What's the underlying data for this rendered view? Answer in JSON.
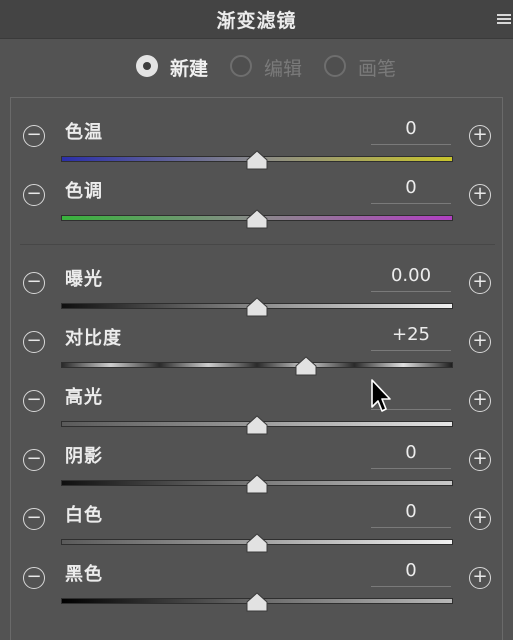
{
  "panel": {
    "title": "渐变滤镜",
    "menu_icon": "hamburger-menu-icon"
  },
  "modes": [
    {
      "label": "新建",
      "selected": true
    },
    {
      "label": "编辑",
      "selected": false
    },
    {
      "label": "画笔",
      "selected": false
    }
  ],
  "buttons": {
    "minus": "−",
    "plus": "+"
  },
  "sliders": [
    {
      "label": "色温",
      "value": "0",
      "position": 0.5,
      "gradient": [
        "#2b2fa8",
        "#8a8a8a",
        "#c8c42c"
      ]
    },
    {
      "label": "色调",
      "value": "0",
      "position": 0.5,
      "gradient": [
        "#38b23c",
        "#8a8a8a",
        "#b03fc1"
      ]
    },
    {
      "label": "曝光",
      "value": "0.00",
      "position": 0.5,
      "gradient": [
        "#0f0f0f",
        "#8a8a8a",
        "#f0f0f0"
      ]
    },
    {
      "label": "对比度",
      "value": "+25",
      "position": 0.625,
      "gradient": [
        "#2a2a2a",
        "#cfcfcf",
        "#2a2a2a",
        "#cfcfcf",
        "#2a2a2a",
        "#cfcfcf",
        "#2a2a2a",
        "#e0e0e0",
        "#1e1e1e"
      ]
    },
    {
      "label": "高光",
      "value": "",
      "position": 0.5,
      "gradient": [
        "#5a5a5a",
        "#9a9a9a",
        "#e6e6e6"
      ]
    },
    {
      "label": "阴影",
      "value": "0",
      "position": 0.5,
      "gradient": [
        "#0f0f0f",
        "#7a7a7a",
        "#c8c8c8"
      ]
    },
    {
      "label": "白色",
      "value": "0",
      "position": 0.5,
      "gradient": [
        "#5a5a5a",
        "#a0a0a0",
        "#f2f2f2"
      ]
    },
    {
      "label": "黑色",
      "value": "0",
      "position": 0.5,
      "gradient": [
        "#000000",
        "#6a6a6a",
        "#b8b8b8"
      ]
    }
  ]
}
